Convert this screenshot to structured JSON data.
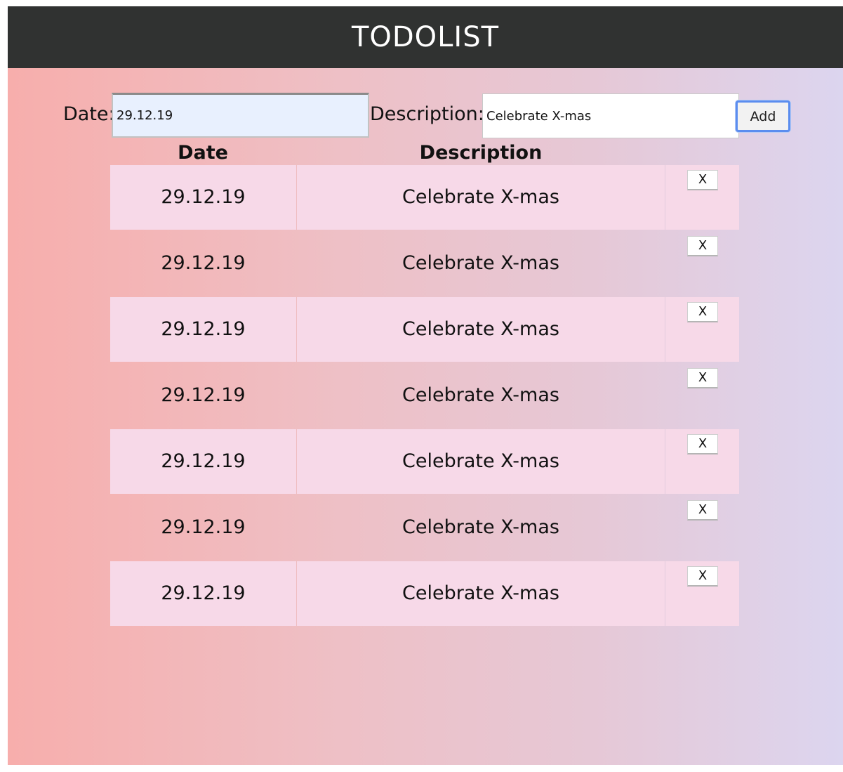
{
  "header": {
    "title": "TODOLIST"
  },
  "form": {
    "date_label": "Date:",
    "date_value": "29.12.19",
    "description_label": "Description:",
    "description_value": "Celebrate X-mas",
    "add_label": "Add"
  },
  "table": {
    "columns": [
      "Date",
      "Description"
    ],
    "delete_label": "X",
    "rows": [
      {
        "date": "29.12.19",
        "description": "Celebrate X-mas"
      },
      {
        "date": "29.12.19",
        "description": "Celebrate X-mas"
      },
      {
        "date": "29.12.19",
        "description": "Celebrate X-mas"
      },
      {
        "date": "29.12.19",
        "description": "Celebrate X-mas"
      },
      {
        "date": "29.12.19",
        "description": "Celebrate X-mas"
      },
      {
        "date": "29.12.19",
        "description": "Celebrate X-mas"
      },
      {
        "date": "29.12.19",
        "description": "Celebrate X-mas"
      }
    ]
  },
  "colors": {
    "header_bg": "#303231",
    "gradient_left": "#f7aeac",
    "gradient_right": "#dcd5ef",
    "row_shade": "#f7d9e8",
    "add_button_focus": "#5b8def",
    "date_input_bg": "#e8f0fe"
  }
}
